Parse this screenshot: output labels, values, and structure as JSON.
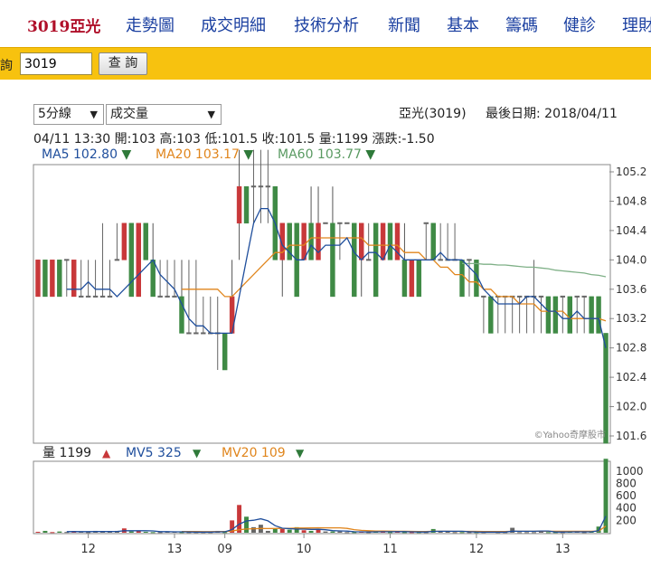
{
  "nav": {
    "brand": "3019亞光",
    "items": [
      "走勢圖",
      "成交明細",
      "技術分析",
      "新聞",
      "基本",
      "籌碼",
      "健診",
      "理財"
    ]
  },
  "search": {
    "label": "查詢",
    "value": "3019",
    "button": "查 詢"
  },
  "controls": {
    "period": "5分線",
    "indicator": "成交量"
  },
  "header": {
    "stock": "亞光(3019)",
    "last_date": "最後日期: 2018/04/11"
  },
  "quote": "04/11 13:30 開:103 高:103 低:101.5 收:101.5 量:1199 漲跌:-1.50",
  "ma": {
    "ma5": {
      "label": "MA5 102.80",
      "arrow": "▼",
      "color": "#1f4e9c"
    },
    "ma20": {
      "label": "MA20 103.17",
      "arrow": "▼",
      "color": "#e0851c"
    },
    "ma60": {
      "label": "MA60 103.77",
      "arrow": "▼",
      "color": "#5a9a62"
    }
  },
  "vol_legend": {
    "vol": {
      "label": "量 1199",
      "arrow": "▲"
    },
    "mv5": {
      "label": "MV5 325",
      "arrow": "▼"
    },
    "mv20": {
      "label": "MV20 109",
      "arrow": "▼"
    }
  },
  "watermark": "©Yahoo奇摩股市",
  "colors": {
    "up": "#c8383a",
    "down": "#3f8a45",
    "doji": "#666666",
    "ma5": "#1f4e9c",
    "ma20": "#e0851c",
    "ma60": "#7fb087",
    "nav": "#1a3fa0",
    "brand": "#b0102a",
    "bar": "#f7c20f"
  },
  "chart_data": {
    "type": "candlestick",
    "price_ticks": [
      "105.2",
      "104.8",
      "104.4",
      "104.0",
      "103.6",
      "103.2",
      "102.8",
      "102.4",
      "102.0",
      "101.6"
    ],
    "price_ylim": [
      101.6,
      105.2
    ],
    "volume_ticks": [
      "1000",
      "800",
      "600",
      "400",
      "200"
    ],
    "volume_ylim": [
      0,
      1100
    ],
    "x_labels": [
      "12",
      "13",
      "09",
      "10",
      "11",
      "12",
      "13"
    ],
    "candles": [
      {
        "o": 103.5,
        "h": 104.0,
        "l": 103.5,
        "c": 104.0
      },
      {
        "o": 104.0,
        "h": 104.0,
        "l": 103.5,
        "c": 103.5
      },
      {
        "o": 103.5,
        "h": 104.0,
        "l": 103.5,
        "c": 104.0
      },
      {
        "o": 104.0,
        "h": 104.0,
        "l": 103.5,
        "c": 103.5
      },
      {
        "o": 104.0,
        "h": 104.0,
        "l": 103.5,
        "c": 104.0
      },
      {
        "o": 103.5,
        "h": 104.0,
        "l": 103.5,
        "c": 104.0
      },
      {
        "o": 103.5,
        "h": 104.0,
        "l": 103.5,
        "c": 103.5
      },
      {
        "o": 103.5,
        "h": 104.0,
        "l": 103.5,
        "c": 103.5
      },
      {
        "o": 103.5,
        "h": 104.0,
        "l": 103.5,
        "c": 103.5
      },
      {
        "o": 103.5,
        "h": 104.5,
        "l": 103.5,
        "c": 103.5
      },
      {
        "o": 103.5,
        "h": 104.0,
        "l": 103.5,
        "c": 103.5
      },
      {
        "o": 104.0,
        "h": 104.5,
        "l": 104.0,
        "c": 104.0
      },
      {
        "o": 104.0,
        "h": 104.5,
        "l": 104.0,
        "c": 104.5
      },
      {
        "o": 104.5,
        "h": 104.5,
        "l": 103.5,
        "c": 103.5
      },
      {
        "o": 103.5,
        "h": 104.5,
        "l": 103.5,
        "c": 104.5
      },
      {
        "o": 104.5,
        "h": 104.5,
        "l": 104.0,
        "c": 104.0
      },
      {
        "o": 104.0,
        "h": 104.5,
        "l": 103.5,
        "c": 103.5
      },
      {
        "o": 103.5,
        "h": 104.0,
        "l": 103.5,
        "c": 103.5
      },
      {
        "o": 103.5,
        "h": 104.0,
        "l": 103.5,
        "c": 103.5
      },
      {
        "o": 103.5,
        "h": 104.0,
        "l": 103.5,
        "c": 103.5
      },
      {
        "o": 103.5,
        "h": 104.0,
        "l": 103.0,
        "c": 103.0
      },
      {
        "o": 103.0,
        "h": 104.0,
        "l": 103.0,
        "c": 103.0
      },
      {
        "o": 103.0,
        "h": 104.0,
        "l": 103.0,
        "c": 103.0
      },
      {
        "o": 103.0,
        "h": 103.5,
        "l": 103.0,
        "c": 103.0
      },
      {
        "o": 103.0,
        "h": 103.5,
        "l": 103.0,
        "c": 103.0
      },
      {
        "o": 103.0,
        "h": 103.5,
        "l": 102.5,
        "c": 103.0
      },
      {
        "o": 103.0,
        "h": 103.0,
        "l": 102.5,
        "c": 102.5
      },
      {
        "o": 103.0,
        "h": 104.0,
        "l": 103.0,
        "c": 103.5
      },
      {
        "o": 104.5,
        "h": 105.5,
        "l": 104.0,
        "c": 105.0
      },
      {
        "o": 105.0,
        "h": 105.0,
        "l": 104.5,
        "c": 104.5
      },
      {
        "o": 105.0,
        "h": 105.5,
        "l": 104.5,
        "c": 105.0
      },
      {
        "o": 105.0,
        "h": 105.5,
        "l": 104.5,
        "c": 105.0
      },
      {
        "o": 105.0,
        "h": 105.5,
        "l": 104.5,
        "c": 105.0
      },
      {
        "o": 105.0,
        "h": 105.0,
        "l": 104.0,
        "c": 104.0
      },
      {
        "o": 104.0,
        "h": 104.5,
        "l": 103.5,
        "c": 104.5
      },
      {
        "o": 104.5,
        "h": 104.5,
        "l": 104.0,
        "c": 104.0
      },
      {
        "o": 104.5,
        "h": 104.5,
        "l": 103.5,
        "c": 103.5
      },
      {
        "o": 104.0,
        "h": 104.5,
        "l": 104.0,
        "c": 104.5
      },
      {
        "o": 104.5,
        "h": 105.0,
        "l": 104.0,
        "c": 104.0
      },
      {
        "o": 104.0,
        "h": 105.0,
        "l": 104.0,
        "c": 104.5
      },
      {
        "o": 104.5,
        "h": 104.5,
        "l": 104.5,
        "c": 104.5
      },
      {
        "o": 104.5,
        "h": 105.0,
        "l": 103.5,
        "c": 103.5
      },
      {
        "o": 104.5,
        "h": 104.5,
        "l": 104.0,
        "c": 104.5
      },
      {
        "o": 104.5,
        "h": 104.5,
        "l": 104.5,
        "c": 104.5
      },
      {
        "o": 104.5,
        "h": 104.5,
        "l": 103.5,
        "c": 103.5
      },
      {
        "o": 104.0,
        "h": 104.5,
        "l": 103.5,
        "c": 104.5
      },
      {
        "o": 104.0,
        "h": 104.5,
        "l": 104.0,
        "c": 104.0
      },
      {
        "o": 104.5,
        "h": 104.5,
        "l": 103.5,
        "c": 103.5
      },
      {
        "o": 104.0,
        "h": 104.5,
        "l": 104.0,
        "c": 104.5
      },
      {
        "o": 104.5,
        "h": 104.5,
        "l": 104.0,
        "c": 104.0
      },
      {
        "o": 104.0,
        "h": 104.5,
        "l": 104.0,
        "c": 104.5
      },
      {
        "o": 104.0,
        "h": 104.5,
        "l": 103.5,
        "c": 103.5
      },
      {
        "o": 103.5,
        "h": 104.0,
        "l": 103.5,
        "c": 104.0
      },
      {
        "o": 104.0,
        "h": 104.0,
        "l": 103.5,
        "c": 103.5
      },
      {
        "o": 104.5,
        "h": 104.5,
        "l": 104.0,
        "c": 104.5
      },
      {
        "o": 104.5,
        "h": 104.5,
        "l": 104.0,
        "c": 104.0
      },
      {
        "o": 104.0,
        "h": 104.5,
        "l": 104.0,
        "c": 104.0
      },
      {
        "o": 104.0,
        "h": 104.5,
        "l": 104.0,
        "c": 104.0
      },
      {
        "o": 104.0,
        "h": 104.5,
        "l": 104.0,
        "c": 104.0
      },
      {
        "o": 104.0,
        "h": 104.0,
        "l": 103.5,
        "c": 103.5
      },
      {
        "o": 104.0,
        "h": 104.0,
        "l": 103.5,
        "c": 104.0
      },
      {
        "o": 104.0,
        "h": 104.0,
        "l": 103.5,
        "c": 103.5
      },
      {
        "o": 103.5,
        "h": 103.5,
        "l": 103.0,
        "c": 103.5
      },
      {
        "o": 103.5,
        "h": 103.5,
        "l": 103.0,
        "c": 103.0
      },
      {
        "o": 103.5,
        "h": 103.5,
        "l": 103.0,
        "c": 103.5
      },
      {
        "o": 103.5,
        "h": 103.5,
        "l": 103.0,
        "c": 103.5
      },
      {
        "o": 103.5,
        "h": 103.5,
        "l": 103.0,
        "c": 103.5
      },
      {
        "o": 103.5,
        "h": 103.5,
        "l": 103.0,
        "c": 103.5
      },
      {
        "o": 103.5,
        "h": 103.5,
        "l": 103.0,
        "c": 103.5
      },
      {
        "o": 103.5,
        "h": 104.0,
        "l": 103.0,
        "c": 103.5
      },
      {
        "o": 103.5,
        "h": 103.5,
        "l": 103.0,
        "c": 103.5
      },
      {
        "o": 103.5,
        "h": 103.5,
        "l": 103.0,
        "c": 103.0
      },
      {
        "o": 103.5,
        "h": 103.5,
        "l": 103.0,
        "c": 103.0
      },
      {
        "o": 103.5,
        "h": 103.5,
        "l": 103.0,
        "c": 103.5
      },
      {
        "o": 103.5,
        "h": 103.5,
        "l": 103.0,
        "c": 103.0
      },
      {
        "o": 103.5,
        "h": 103.5,
        "l": 103.0,
        "c": 103.5
      },
      {
        "o": 103.5,
        "h": 103.5,
        "l": 103.0,
        "c": 103.5
      },
      {
        "o": 103.5,
        "h": 103.5,
        "l": 103.0,
        "c": 103.0
      },
      {
        "o": 103.5,
        "h": 103.5,
        "l": 103.0,
        "c": 103.0
      },
      {
        "o": 103.0,
        "h": 103.0,
        "l": 101.5,
        "c": 101.5
      }
    ],
    "ma5": [
      null,
      null,
      null,
      null,
      103.6,
      103.6,
      103.6,
      103.7,
      103.6,
      103.6,
      103.6,
      103.5,
      103.6,
      103.7,
      103.8,
      103.9,
      104.0,
      103.8,
      103.7,
      103.6,
      103.4,
      103.2,
      103.1,
      103.1,
      103.0,
      103.0,
      103.0,
      103.0,
      103.5,
      104.0,
      104.5,
      104.7,
      104.7,
      104.5,
      104.2,
      104.1,
      104.0,
      104.0,
      104.2,
      104.1,
      104.2,
      104.2,
      104.2,
      104.3,
      104.1,
      104.0,
      104.1,
      104.1,
      104.0,
      104.2,
      104.1,
      104.0,
      104.0,
      104.0,
      104.0,
      104.0,
      104.1,
      104.0,
      104.0,
      104.0,
      103.9,
      103.8,
      103.6,
      103.5,
      103.4,
      103.4,
      103.4,
      103.4,
      103.5,
      103.5,
      103.4,
      103.3,
      103.3,
      103.2,
      103.2,
      103.3,
      103.2,
      103.2,
      103.2,
      102.8
    ],
    "ma20": [
      null,
      null,
      null,
      null,
      null,
      null,
      null,
      null,
      null,
      null,
      null,
      null,
      null,
      null,
      null,
      null,
      null,
      null,
      null,
      null,
      103.6,
      103.6,
      103.6,
      103.6,
      103.6,
      103.6,
      103.5,
      103.5,
      103.6,
      103.7,
      103.8,
      103.9,
      104.0,
      104.1,
      104.1,
      104.2,
      104.2,
      104.2,
      104.3,
      104.3,
      104.3,
      104.3,
      104.3,
      104.3,
      104.3,
      104.3,
      104.2,
      104.2,
      104.2,
      104.2,
      104.2,
      104.1,
      104.1,
      104.1,
      104.0,
      104.0,
      103.9,
      103.9,
      103.8,
      103.8,
      103.7,
      103.7,
      103.6,
      103.6,
      103.5,
      103.5,
      103.5,
      103.4,
      103.4,
      103.4,
      103.3,
      103.3,
      103.3,
      103.3,
      103.2,
      103.2,
      103.2,
      103.2,
      103.2,
      103.17
    ],
    "ma60": [
      null,
      null,
      null,
      null,
      null,
      null,
      null,
      null,
      null,
      null,
      null,
      null,
      null,
      null,
      null,
      null,
      null,
      null,
      null,
      null,
      null,
      null,
      null,
      null,
      null,
      null,
      null,
      null,
      null,
      null,
      null,
      null,
      null,
      null,
      null,
      null,
      null,
      null,
      null,
      null,
      null,
      null,
      null,
      null,
      null,
      null,
      null,
      null,
      null,
      null,
      null,
      null,
      null,
      null,
      null,
      null,
      null,
      null,
      null,
      103.95,
      103.95,
      103.95,
      103.94,
      103.94,
      103.93,
      103.93,
      103.92,
      103.91,
      103.9,
      103.9,
      103.89,
      103.88,
      103.86,
      103.85,
      103.84,
      103.83,
      103.82,
      103.8,
      103.79,
      103.77
    ],
    "volume": [
      15,
      30,
      10,
      20,
      12,
      25,
      20,
      10,
      30,
      20,
      15,
      30,
      70,
      20,
      30,
      15,
      10,
      10,
      20,
      15,
      10,
      10,
      10,
      10,
      10,
      30,
      10,
      200,
      450,
      260,
      90,
      130,
      30,
      60,
      60,
      50,
      90,
      40,
      30,
      60,
      20,
      20,
      20,
      10,
      10,
      15,
      10,
      20,
      25,
      10,
      20,
      10,
      10,
      10,
      10,
      60,
      20,
      20,
      10,
      10,
      10,
      10,
      10,
      15,
      10,
      10,
      80,
      10,
      10,
      10,
      20,
      10,
      10,
      10,
      15,
      20,
      10,
      20,
      100,
      1199
    ],
    "mv5": [
      null,
      null,
      null,
      null,
      17,
      19,
      17,
      17,
      19,
      21,
      19,
      21,
      33,
      33,
      33,
      33,
      29,
      17,
      17,
      14,
      14,
      13,
      11,
      10,
      10,
      14,
      14,
      52,
      140,
      190,
      203,
      226,
      192,
      114,
      74,
      66,
      58,
      58,
      54,
      56,
      48,
      34,
      30,
      26,
      16,
      15,
      13,
      15,
      16,
      16,
      17,
      17,
      15,
      12,
      12,
      22,
      24,
      24,
      24,
      24,
      16,
      12,
      10,
      11,
      11,
      11,
      25,
      24,
      24,
      24,
      28,
      28,
      12,
      12,
      13,
      15,
      15,
      15,
      33,
      270
    ],
    "mv20": [
      null,
      null,
      null,
      null,
      null,
      null,
      null,
      null,
      null,
      null,
      null,
      null,
      null,
      null,
      null,
      null,
      null,
      null,
      null,
      null,
      20,
      19,
      19,
      18,
      18,
      19,
      19,
      28,
      48,
      60,
      64,
      69,
      67,
      69,
      70,
      72,
      76,
      77,
      78,
      80,
      79,
      79,
      79,
      70,
      50,
      38,
      33,
      26,
      26,
      25,
      24,
      23,
      22,
      21,
      21,
      23,
      23,
      23,
      22,
      22,
      22,
      22,
      21,
      21,
      21,
      21,
      24,
      24,
      24,
      24,
      24,
      24,
      24,
      23,
      24,
      24,
      23,
      23,
      27,
      109
    ]
  }
}
